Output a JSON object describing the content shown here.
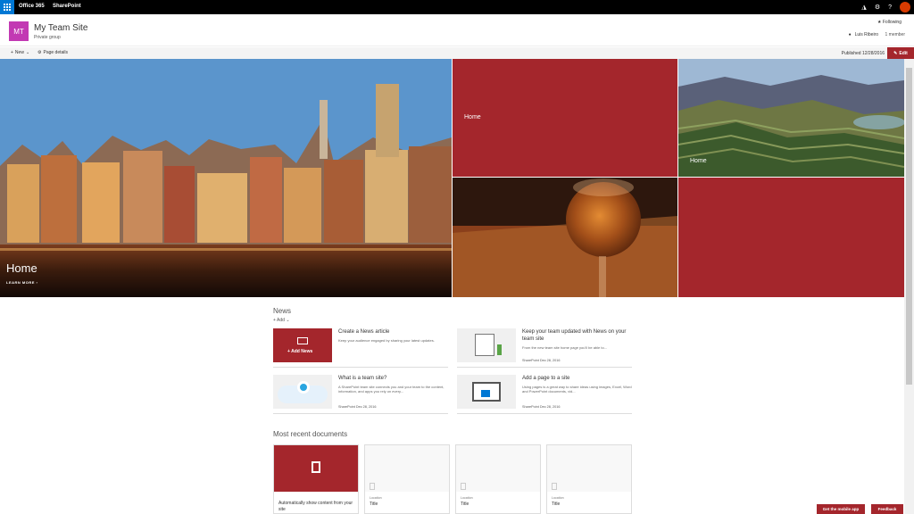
{
  "suite": {
    "app_name": "Office 365",
    "product": "SharePoint",
    "icons": [
      "bell-icon",
      "gear-icon",
      "help-icon",
      "avatar"
    ]
  },
  "site": {
    "logo_text": "MT",
    "title": "My Team Site",
    "subtitle": "Private group",
    "following": "Following",
    "user": "Luis Ribeiro",
    "members": "1 member"
  },
  "commands": {
    "new": "New",
    "page_details": "Page details",
    "published": "Published 12/28/2016",
    "edit": "Edit"
  },
  "hero": {
    "main_title": "Home",
    "learn_more": "LEARN MORE",
    "tile_top_red": "Home",
    "tile_landscape": "Home"
  },
  "news": {
    "title": "News",
    "add": "Add",
    "cards": [
      {
        "title": "Create a News article",
        "desc": "Keep your audience engaged by sharing your latest updates.",
        "button": "+ Add News"
      },
      {
        "title": "Keep your team updated with News on your team site",
        "desc": "From the new team site home page you'll be able to...",
        "meta": "SharePoint  Dec 28, 2016"
      },
      {
        "title": "What is a team site?",
        "desc": "A SharePoint team site connects you and your team to the content, information, and apps you rely on every...",
        "meta": "SharePoint  Dec 28, 2016"
      },
      {
        "title": "Add a page to a site",
        "desc": "Using pages is a great way to share ideas using images, Excel, Word and PowerPoint documents, vid...",
        "meta": "SharePoint  Dec 28, 2016"
      }
    ]
  },
  "docs": {
    "title": "Most recent documents",
    "auto_text": "Automatically show content from your site",
    "cards": [
      {
        "location": "Location",
        "title": "Title"
      },
      {
        "location": "Location",
        "title": "Title"
      },
      {
        "location": "Location",
        "title": "Title"
      }
    ]
  },
  "footer": {
    "mobile": "Get the mobile app",
    "feedback": "Feedback"
  },
  "colors": {
    "suite_bg": "#000000",
    "waffle": "#0078d4",
    "accent": "#a4262c",
    "logo": "#c239b3"
  }
}
